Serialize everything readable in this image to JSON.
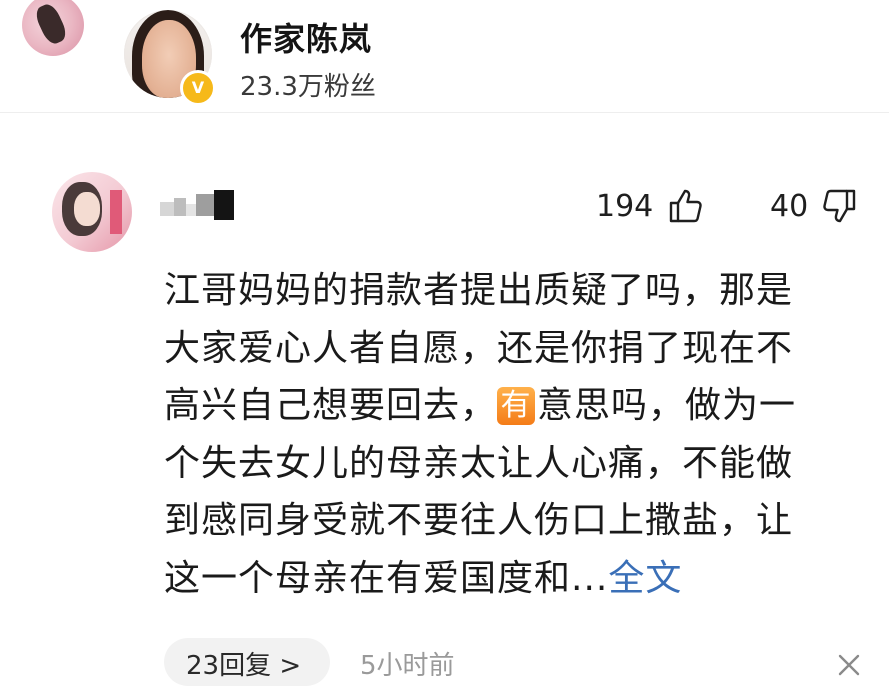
{
  "author": {
    "name": "作家陈岚",
    "fans": "23.3万粉丝",
    "verified_badge": "V",
    "badge_color": "#f6b91a"
  },
  "comment": {
    "likes": "194",
    "dislikes": "40",
    "lines": [
      "江哥妈妈的捐款者提出质疑了吗，那是",
      "大家爱心人者自愿，还是你捐了现在不",
      "高兴自己想要回去，"
    ],
    "emoji_char": "有",
    "line3_after_emoji": "意思吗，做为一",
    "lines_rest": [
      "个失去女儿的母亲太让人心痛，不能做",
      "到感同身受就不要往人伤口上撒盐，让"
    ],
    "last_line": "这一个母亲在有爱国度和...",
    "more_label": "全文",
    "link_color": "#3a6fb7"
  },
  "footer": {
    "replies": "23回复 >",
    "time": "5小时前"
  },
  "icons": {
    "like": "thumbs-up-icon",
    "dislike": "thumbs-down-icon",
    "close": "close-icon"
  }
}
